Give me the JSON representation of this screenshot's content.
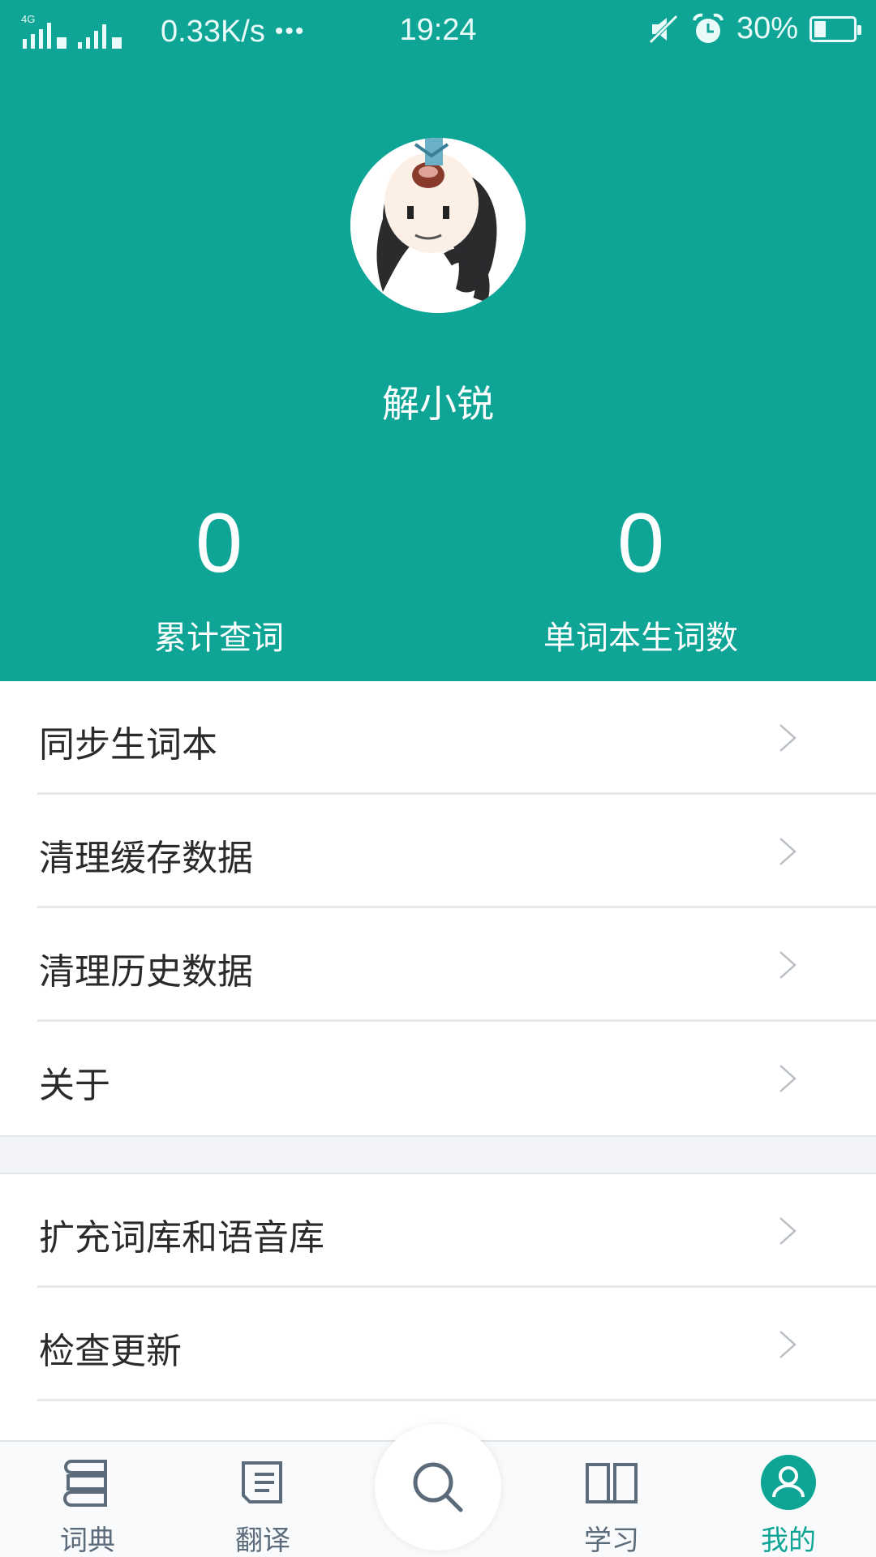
{
  "status_bar": {
    "network": "4G",
    "speed": "0.33K/s",
    "dots": "•••",
    "time": "19:24",
    "battery": "30%"
  },
  "profile": {
    "username": "解小锐"
  },
  "stats": [
    {
      "value": "0",
      "label": "累计查词"
    },
    {
      "value": "0",
      "label": "单词本生词数"
    }
  ],
  "menu": {
    "group1": [
      "同步生词本",
      "清理缓存数据",
      "清理历史数据",
      "关于"
    ],
    "group2": [
      "扩充词库和语音库",
      "检查更新"
    ]
  },
  "bottom_nav": {
    "items": [
      {
        "label": "词典",
        "icon": "dictionary-icon"
      },
      {
        "label": "翻译",
        "icon": "translate-icon"
      },
      {
        "label": "",
        "icon": "search-icon"
      },
      {
        "label": "学习",
        "icon": "book-icon"
      },
      {
        "label": "我的",
        "icon": "profile-icon"
      }
    ]
  },
  "colors": {
    "header": "#0fa596",
    "accent": "#0fa596"
  }
}
